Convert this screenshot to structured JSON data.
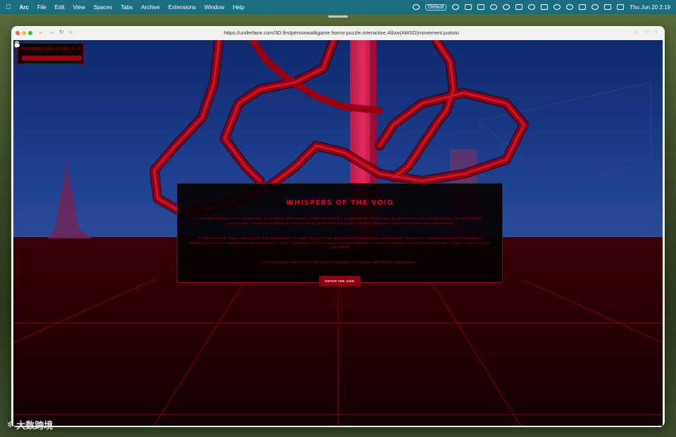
{
  "menubar": {
    "app": "Arc",
    "items": [
      "File",
      "Edit",
      "View",
      "Spaces",
      "Tabs",
      "Archive",
      "Extensions",
      "Window",
      "Help"
    ],
    "profile": "Default",
    "datetime": "Thu Jun 20  2:19"
  },
  "browser": {
    "url": "https://underface.com/3D.firstpersonwalkgame.horror.puzzle.interactive.Allow(AWSD)movement.putsou"
  },
  "game": {
    "hud_label": "WHISPERS COLLECTED: 0 / 5",
    "modal": {
      "title": "WHISPERS OF THE VOID",
      "paragraph1": "YOU FIND YOURSELF IN A TWISTED REALM BETWEEN DIMENSIONS. A KNOTTED ETERNAL MONUMENT OF IMPOSSIBLE GEOMETRY AND SHIFTING SHADOWS. AS A WANDERING INVESTIGATOR, YOU'VE BEEN DRAWN TO THIS PLACE BY WHISPERS OF ANCIENT, CRYPTIC MESSAGES AND UNEXPLAINED DISAPPEARANCES.",
      "paragraph2": "TO UNCOVER THE TRUTH AND ESCAPE THIS NIGHTMARE, YOU MUST COLLECT THE WHISPERS OF THOSE WHO CAME BEFORE - SHARDS OF CONSCIOUSNESS LEFT BEHIND AS PROTECTED ECHOES. BUT BEWARE, EACH WHISPER YOU GATHER BRINGS YOU CLOSER TO UNDERSTANDING THE MONSTROUS NATURE OF THIS PLACE, AND CLOSER TO LOSING YOUR OWN SANITY.",
      "paragraph3": "CAN YOU SOLVE THE MYSTERY OF THE VOID BEFORE YOUR MIND SURRENDERS COMPLETELY?",
      "button": "ENTER THE VOID"
    }
  },
  "watermark": "大数跨境",
  "colors": {
    "menubar": "#1a6e80",
    "sky": "#1a3d82",
    "floor": "#3a0006",
    "accent_red": "#c00018"
  }
}
